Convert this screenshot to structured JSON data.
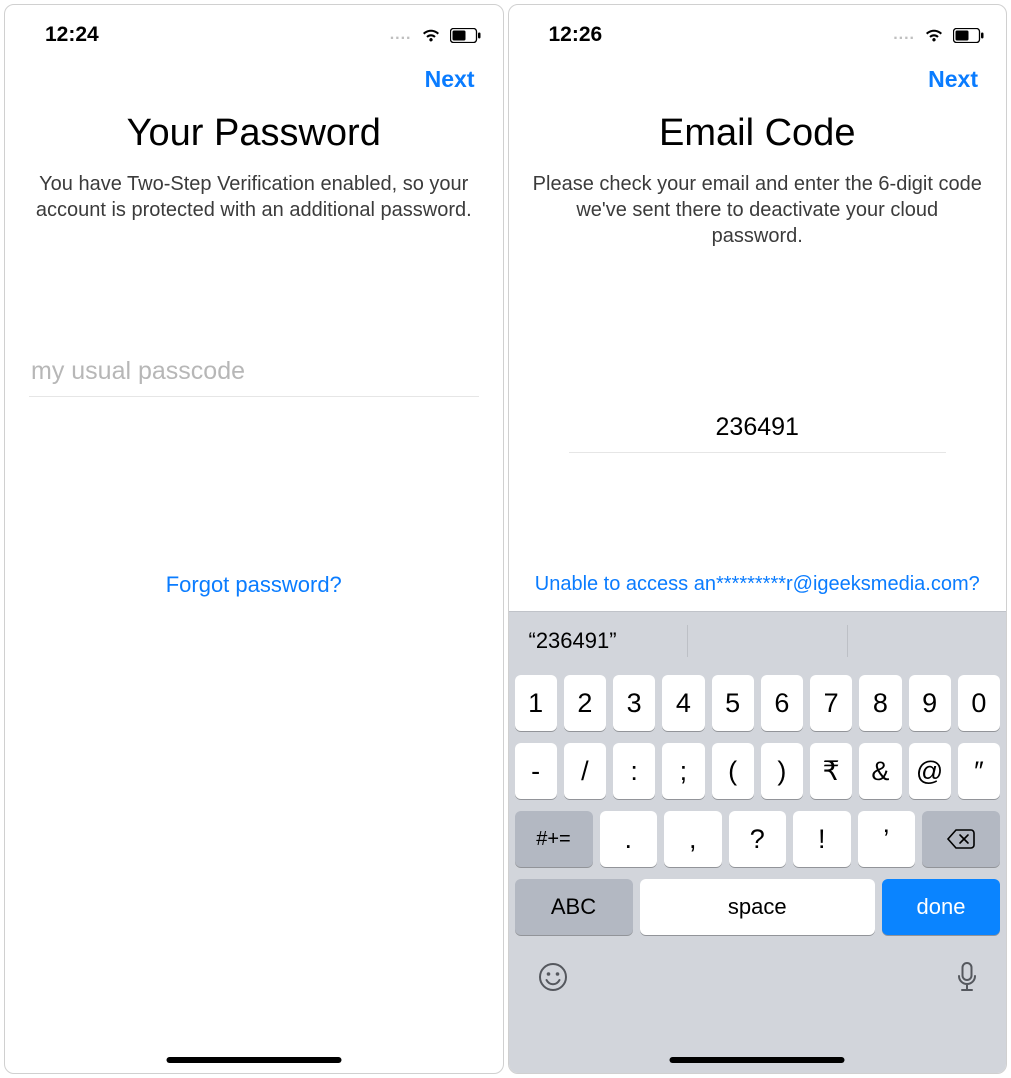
{
  "left": {
    "status_time": "12:24",
    "next_label": "Next",
    "title": "Your Password",
    "desc": "You have Two-Step Verification enabled, so your account is protected with an additional password.",
    "password_placeholder": "my usual passcode",
    "forgot_label": "Forgot password?"
  },
  "right": {
    "status_time": "12:26",
    "next_label": "Next",
    "title": "Email Code",
    "desc": "Please check your email and enter the 6-digit code we've sent there to deactivate your cloud password.",
    "code_value": "236491",
    "unable_label": "Unable to access an*********r@igeeksmedia.com?",
    "suggestion": "“236491”",
    "keys_row1": [
      "1",
      "2",
      "3",
      "4",
      "5",
      "6",
      "7",
      "8",
      "9",
      "0"
    ],
    "keys_row2": [
      "-",
      "/",
      ":",
      ";",
      "(",
      ")",
      "₹",
      "&",
      "@",
      "″"
    ],
    "keys_row3_mod": "#+=",
    "keys_row3": [
      ".",
      ",",
      "?",
      "!",
      "’"
    ],
    "abc_label": "ABC",
    "space_label": "space",
    "done_label": "done"
  }
}
